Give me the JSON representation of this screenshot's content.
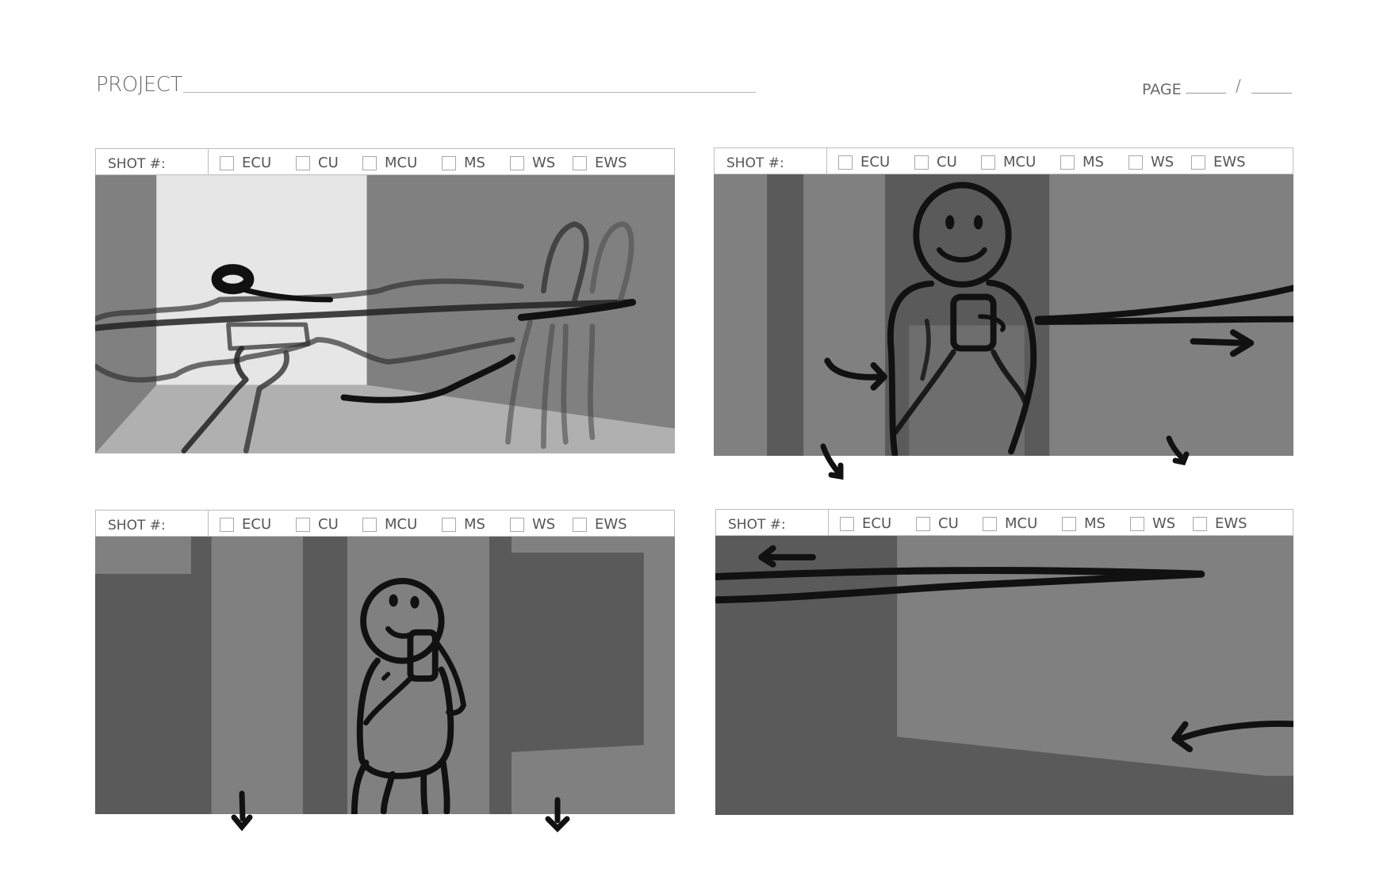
{
  "header": {
    "project_label": "PROJECT",
    "page_label": "PAGE",
    "page_separator": "/"
  },
  "shot_label": "SHOT #:",
  "shot_types": [
    "ECU",
    "CU",
    "MCU",
    "MS",
    "WS",
    "EWS"
  ],
  "panels": [
    {
      "shot_number": "",
      "checked": [],
      "sketch": "hand reaching toward object on table, chair at right, curved arrow"
    },
    {
      "shot_number": "",
      "checked": [],
      "sketch": "smiling figure holding cup in doorway, motion lines and arrows"
    },
    {
      "shot_number": "",
      "checked": [],
      "sketch": "figure drinking from cup in corridor, downward arrows"
    },
    {
      "shot_number": "",
      "checked": [],
      "sketch": "empty room corner with leftward motion lines and arrows"
    }
  ]
}
